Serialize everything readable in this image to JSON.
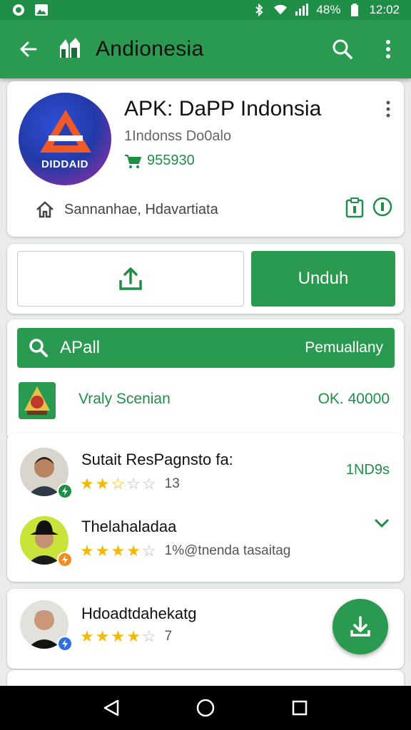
{
  "status_bar": {
    "battery_pct": "48%",
    "time": "12:02"
  },
  "app_bar": {
    "title": "Andionesia"
  },
  "app_card": {
    "logo_text": "DIDDAID",
    "title": "APK: DaPP Indonsia",
    "subtitle": "1Indonss Do0alo",
    "downloads": "955930",
    "developer": "Sannanhae, Hdavartiata"
  },
  "actions": {
    "download_label": "Unduh"
  },
  "search": {
    "label": "APall",
    "right_label": "Pemuallany"
  },
  "featured_app": {
    "name": "Vraly Scenian",
    "price": "OK. 40000"
  },
  "reviews": [
    {
      "name": "Sutait ResPagnsto fa:",
      "rating": 2.5,
      "meta": "13",
      "right": "1ND9s"
    },
    {
      "name": "Thelahaladaa",
      "rating": 4,
      "meta": "1%@tnenda tasaitag"
    },
    {
      "name": "Hdoadtdahekatg",
      "rating": 4,
      "meta": "7"
    }
  ],
  "colors": {
    "primary": "#2a9a50",
    "primary_dark": "#1f8e47",
    "star": "#f2b90d"
  }
}
